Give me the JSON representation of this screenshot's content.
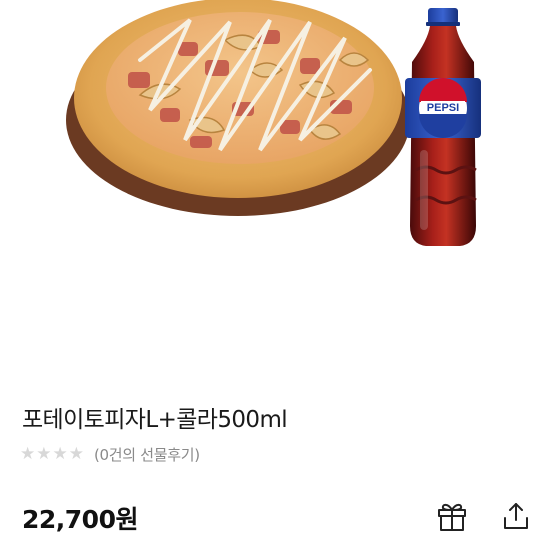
{
  "product": {
    "image_alt": "포테이토피자 L 과 펩시 콜라 500ml",
    "bottle_label": "PEPSI",
    "name": "포테이토피자L+콜라500ml",
    "rating": {
      "value": 0,
      "max": 5,
      "review_text": "(0건의 선물후기)"
    },
    "price": "22,700원"
  },
  "actions": {
    "gift_icon": "gift-icon",
    "share_icon": "share-icon"
  },
  "colors": {
    "star_empty": "#d8d8d8",
    "pepsi_blue": "#1f3fa0",
    "pepsi_red": "#d0112b"
  }
}
